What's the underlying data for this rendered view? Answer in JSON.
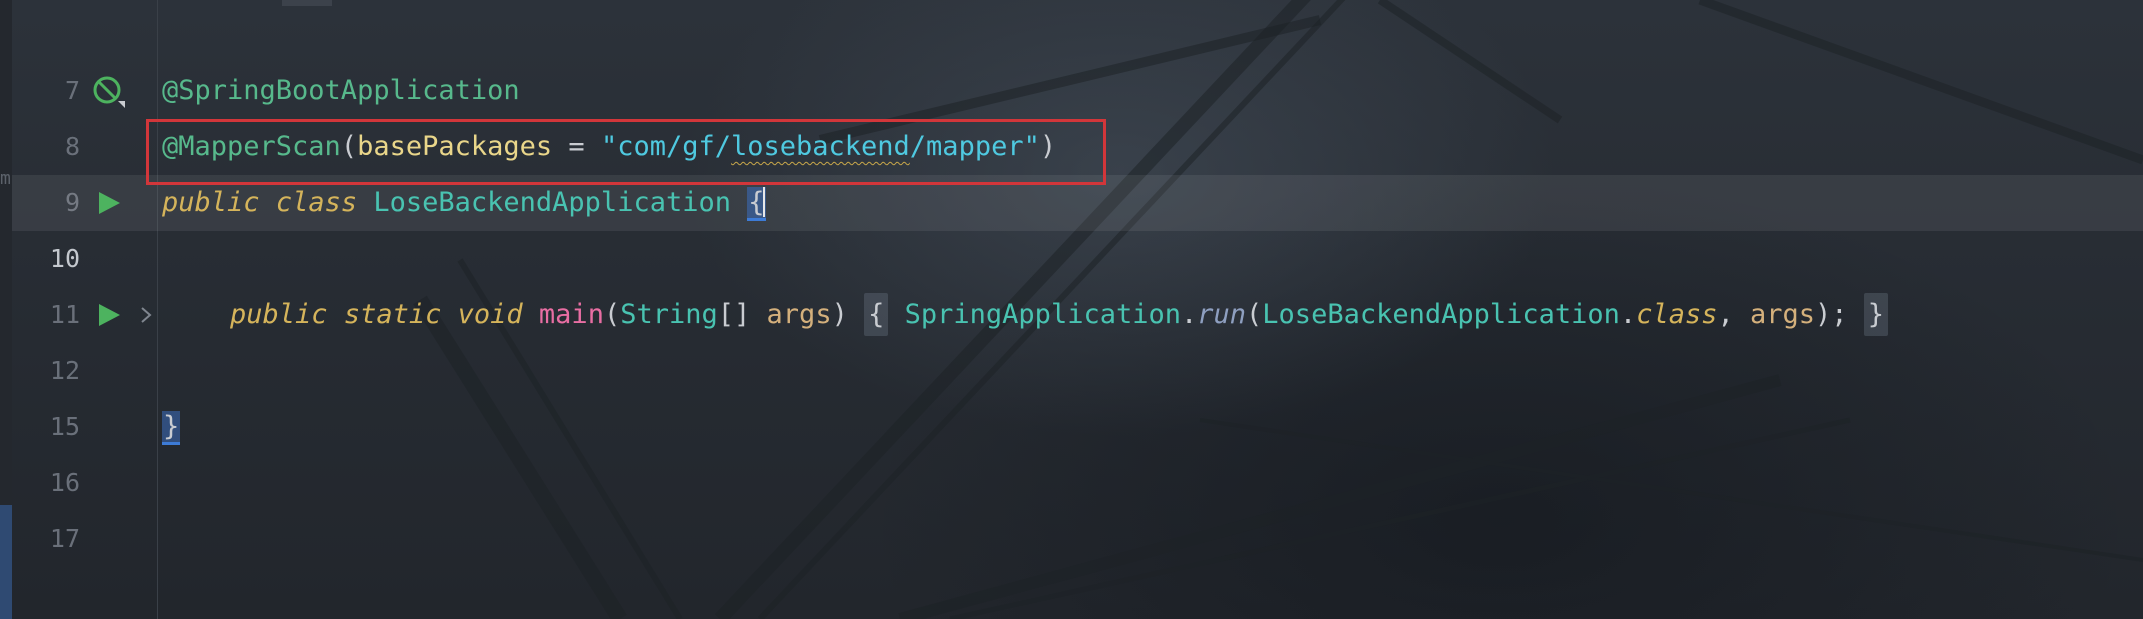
{
  "editor": {
    "left_fragment": "m",
    "lines": [
      {
        "number": "7"
      },
      {
        "number": "8",
        "annotation": "@SpringBootApplication"
      },
      {
        "number": "9",
        "annotation": "@MapperScan",
        "open_paren": "(",
        "param": "basePackages",
        "eq": " = ",
        "str_prefix": "\"com/gf/",
        "str_squiggle": "losebackend",
        "str_suffix": "/mapper\"",
        "close_paren": ")"
      },
      {
        "number": "10",
        "kw1": "public",
        "kw2": "class",
        "class_name": "LoseBackendApplication",
        "brace": "{"
      },
      {
        "number": "11"
      },
      {
        "number": "12",
        "kw1": "public",
        "kw2": "static",
        "kw3": "void",
        "method": "main",
        "p_open": "(",
        "param_type": "String",
        "brackets": "[]",
        "param_name": "args",
        "p_close": ")",
        "fold_open": "{",
        "call_class": "SpringApplication",
        "dot1": ".",
        "call_method": "run",
        "call_open": "(",
        "call_arg1": "LoseBackendApplication",
        "dot2": ".",
        "call_kw": "class",
        "comma": ", ",
        "call_arg2": "args",
        "call_close": ");",
        "fold_close": "}"
      },
      {
        "number": "15"
      },
      {
        "number": "16",
        "brace": "}"
      },
      {
        "number": "17"
      }
    ]
  },
  "icons": {
    "line8": "spring-bean-no-entry-icon",
    "line10": "run-gutter-icon",
    "line12_run": "run-gutter-icon",
    "line12_fold": "fold-chevron-right-icon"
  },
  "colors": {
    "highlight_border": "#d2363a",
    "run_icon": "#4db35f",
    "annotation": "#57b98c",
    "keyword": "#d5b45b",
    "string": "#4fc9e0"
  }
}
